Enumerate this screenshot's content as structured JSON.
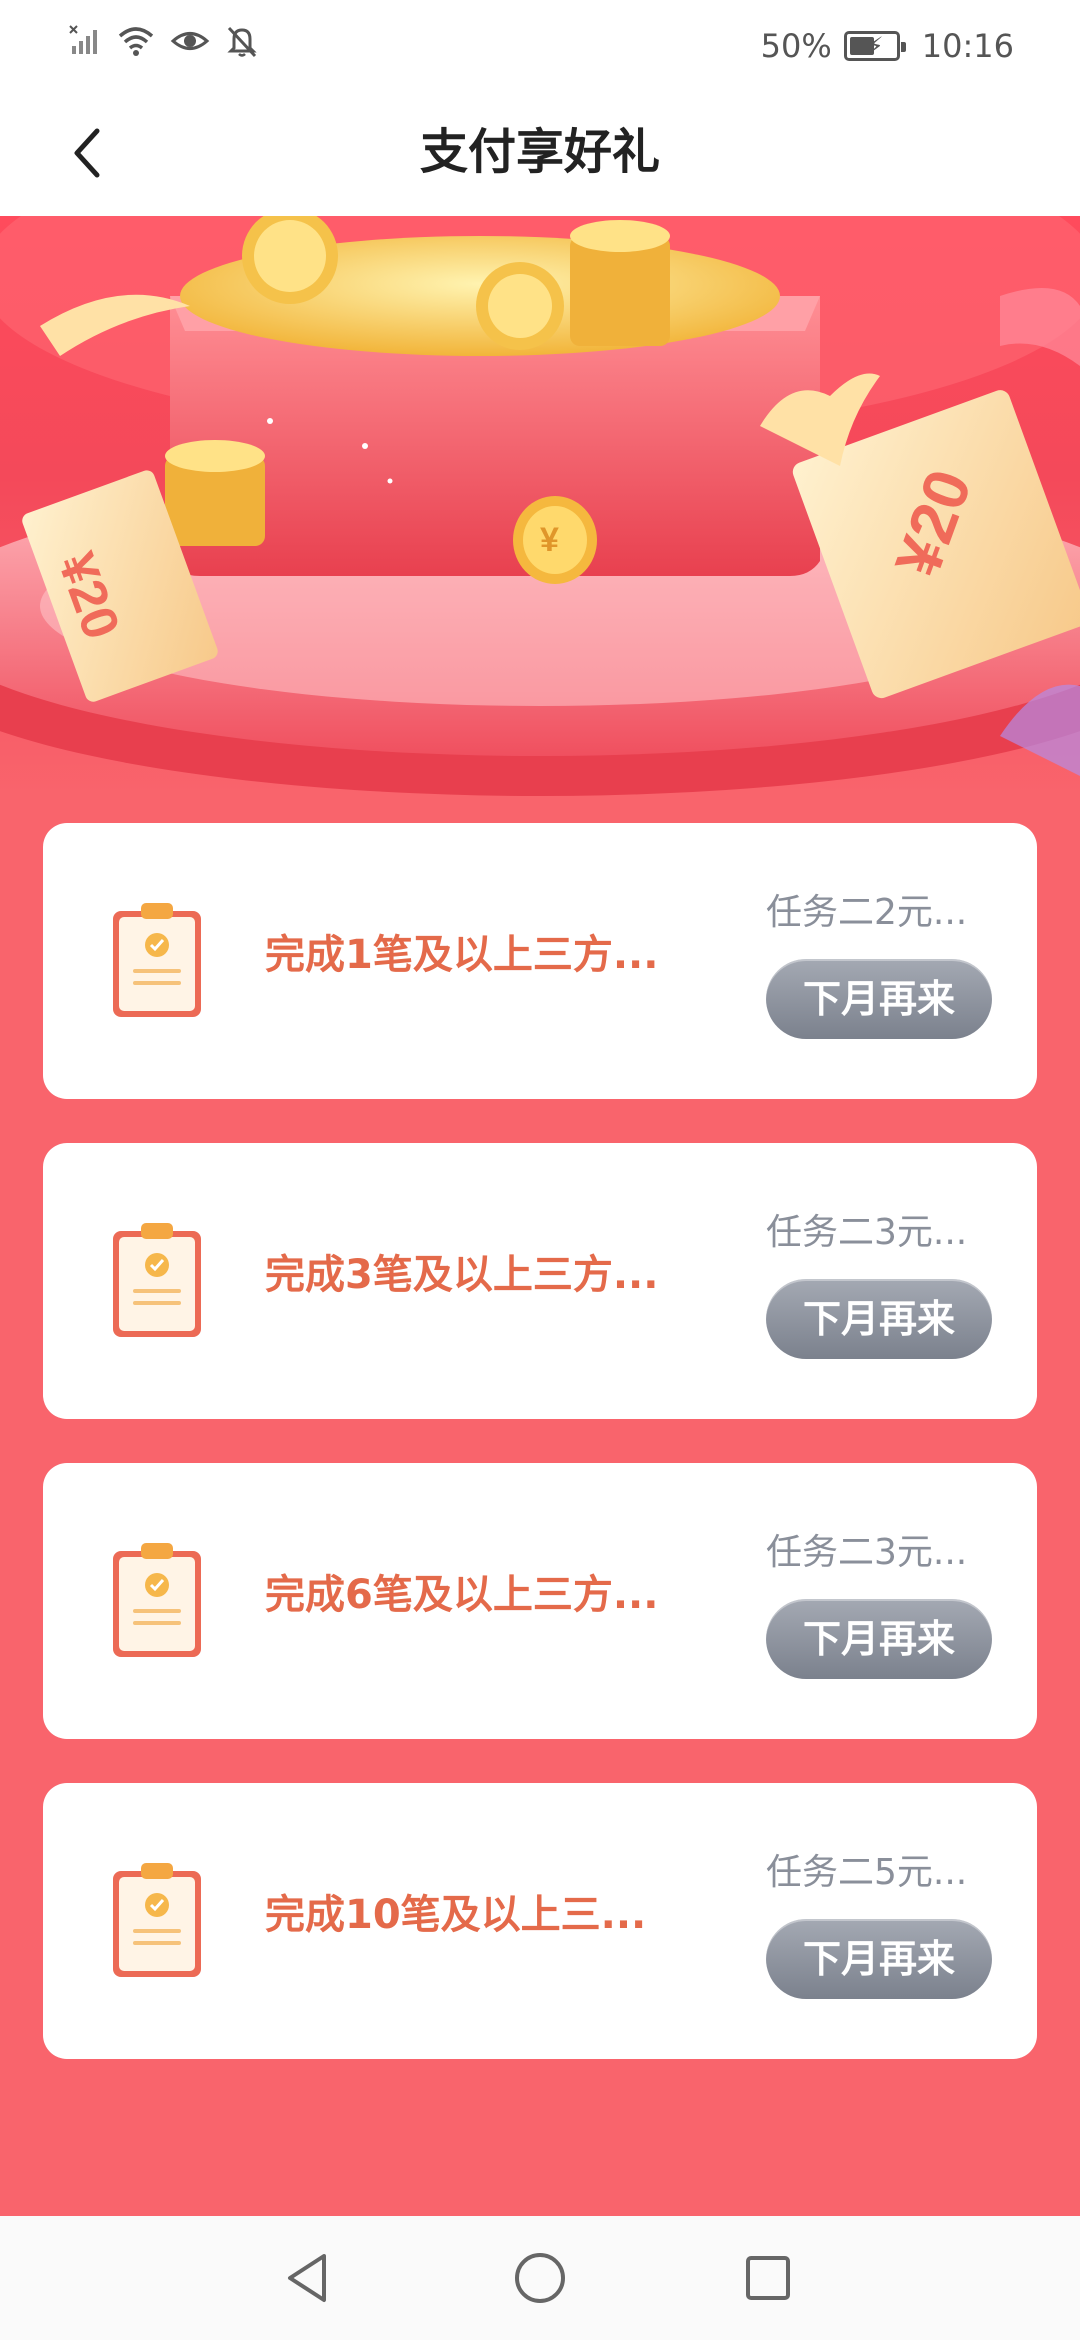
{
  "status_bar": {
    "battery": "50%",
    "time": "10:16",
    "icons": [
      "no-signal-icon",
      "wifi-icon",
      "eye-icon",
      "bell-muted-icon",
      "battery-charging-icon"
    ]
  },
  "header": {
    "title": "支付享好礼",
    "back_icon": "chevron-left-icon"
  },
  "banner": {
    "voucher_left": "¥20",
    "voucher_right": "¥20",
    "coin_symbol": "¥"
  },
  "tasks": [
    {
      "title": "完成1笔及以上三方...",
      "reward": "任务二2元...",
      "button": "下月再来"
    },
    {
      "title": "完成3笔及以上三方...",
      "reward": "任务二3元...",
      "button": "下月再来"
    },
    {
      "title": "完成6笔及以上三方...",
      "reward": "任务二3元...",
      "button": "下月再来"
    },
    {
      "title": "完成10笔及以上三...",
      "reward": "任务二5元...",
      "button": "下月再来"
    }
  ],
  "nav_bar": {
    "icons": [
      "back-triangle-icon",
      "home-circle-icon",
      "recents-square-icon"
    ]
  },
  "colors": {
    "page_bg": "#f9646c",
    "task_title": "#e46a4a",
    "button_gray": "#8d929d"
  }
}
